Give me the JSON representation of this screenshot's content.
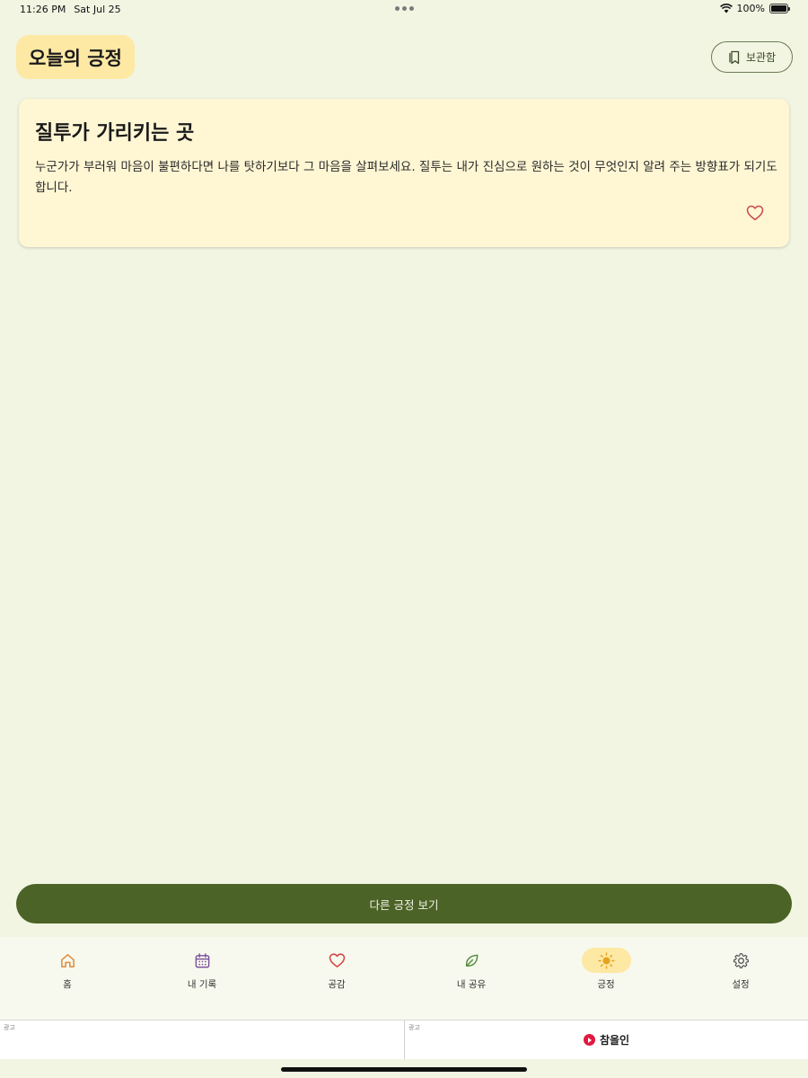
{
  "status": {
    "time": "11:26 PM",
    "date": "Sat Jul 25",
    "battery": "100%"
  },
  "header": {
    "title": "오늘의 긍정",
    "archive_label": "보관함"
  },
  "card": {
    "title": "질투가 가리키는 곳",
    "body": "누군가가 부러워 마음이 불편하다면 나를 탓하기보다 그 마음을 살펴보세요. 질투는 내가 진심으로 원하는 것이 무엇인지 알려 주는 방향표가 되기도 합니다."
  },
  "main_button": {
    "label": "다른 긍정 보기"
  },
  "nav": {
    "items": [
      {
        "label": "홈",
        "icon": "home-icon",
        "color": "#e08a3c"
      },
      {
        "label": "내 기록",
        "icon": "calendar-icon",
        "color": "#7b4f9c"
      },
      {
        "label": "공감",
        "icon": "heart-icon",
        "color": "#d64545"
      },
      {
        "label": "내 공유",
        "icon": "leaf-icon",
        "color": "#4f8a3a"
      },
      {
        "label": "긍정",
        "icon": "sun-icon",
        "color": "#e6a21a",
        "active": true
      },
      {
        "label": "설정",
        "icon": "gear-icon",
        "color": "#555555"
      }
    ]
  },
  "ads": {
    "left_tag": "광고",
    "right_tag": "광고",
    "right_text": "참을인"
  },
  "colors": {
    "background": "#f1f5e2",
    "accent": "#4b6326",
    "highlight": "#fde8a4",
    "card": "#fff6d4"
  }
}
